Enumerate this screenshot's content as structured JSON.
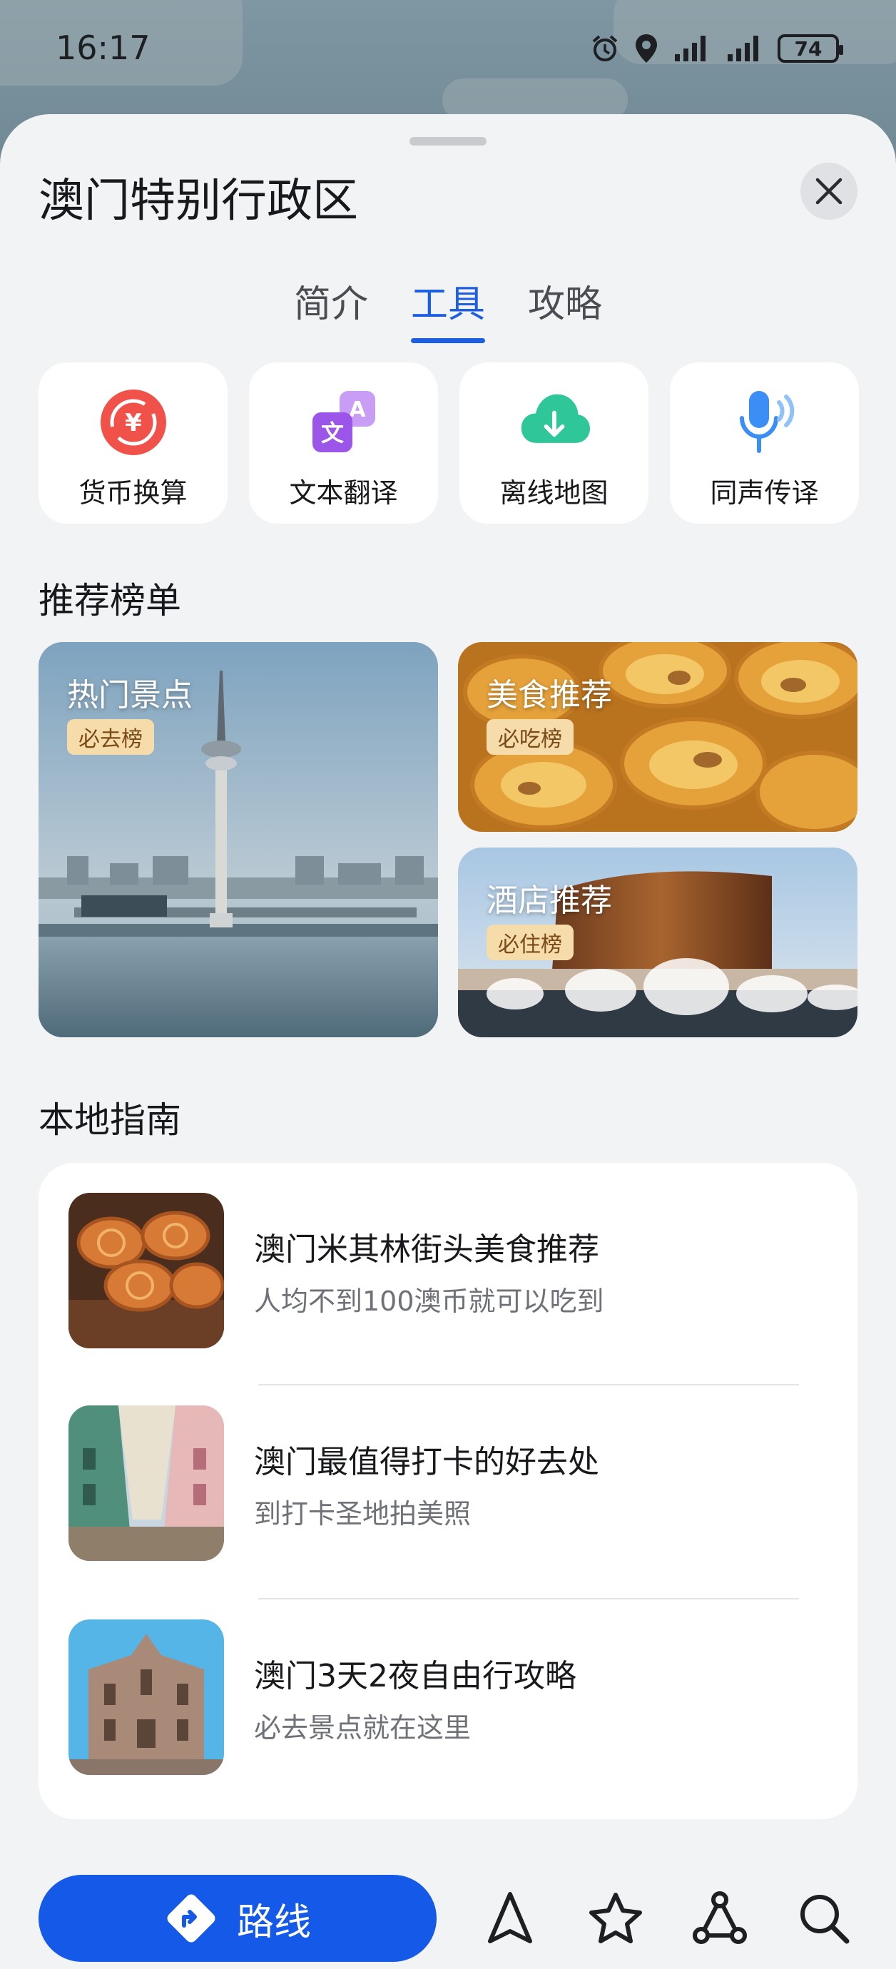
{
  "status_bar": {
    "time": "16:17",
    "battery": "74"
  },
  "sheet": {
    "title": "澳门特别行政区",
    "tabs": [
      {
        "label": "简介",
        "active": false
      },
      {
        "label": "工具",
        "active": true
      },
      {
        "label": "攻略",
        "active": false
      }
    ]
  },
  "tools": [
    {
      "label": "货币换算",
      "icon": "currency-exchange-icon"
    },
    {
      "label": "文本翻译",
      "icon": "text-translate-icon"
    },
    {
      "label": "离线地图",
      "icon": "offline-map-icon"
    },
    {
      "label": "同声传译",
      "icon": "simultaneous-interpretation-icon"
    }
  ],
  "rankings": {
    "title": "推荐榜单",
    "items": [
      {
        "name": "热门景点",
        "badge": "必去榜"
      },
      {
        "name": "美食推荐",
        "badge": "必吃榜"
      },
      {
        "name": "酒店推荐",
        "badge": "必住榜"
      }
    ]
  },
  "guide": {
    "title": "本地指南",
    "items": [
      {
        "title": "澳门米其林街头美食推荐",
        "subtitle": "人均不到100澳币就可以吃到"
      },
      {
        "title": "澳门最值得打卡的好去处",
        "subtitle": "到打卡圣地拍美照"
      },
      {
        "title": "澳门3天2夜自由行攻略",
        "subtitle": "必去景点就在这里"
      }
    ]
  },
  "bottom_bar": {
    "route_label": "路线"
  },
  "colors": {
    "accent": "#1d5fe0",
    "button": "#1459e8"
  }
}
